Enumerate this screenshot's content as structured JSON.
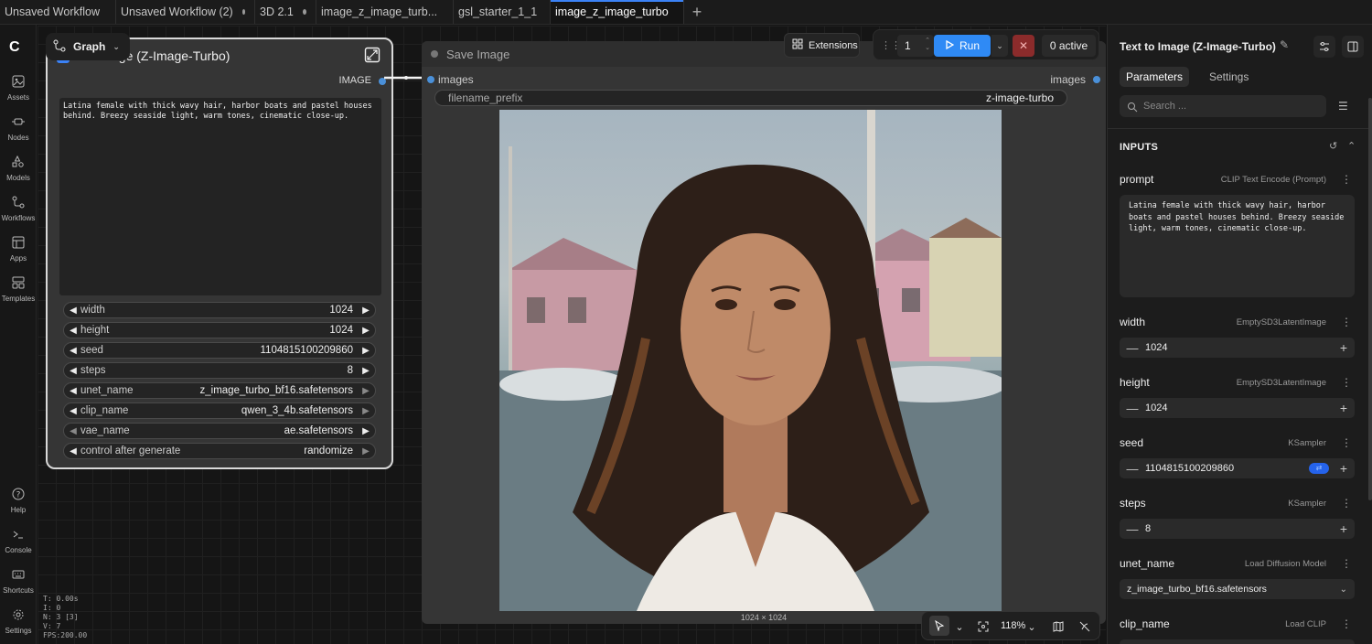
{
  "tabs": [
    {
      "label": "Unsaved Workflow",
      "active": false
    },
    {
      "label": "Unsaved Workflow (2)",
      "active": false
    },
    {
      "label": "3D 2.1",
      "active": false
    },
    {
      "label": "image_z_image_turb...",
      "active": false
    },
    {
      "label": "gsl_starter_1_1",
      "active": false
    },
    {
      "label": "image_z_image_turbo",
      "active": true
    }
  ],
  "nav": {
    "logo": "C",
    "items": [
      {
        "label": "Assets",
        "icon": "image-icon"
      },
      {
        "label": "Nodes",
        "icon": "nodes-icon"
      },
      {
        "label": "Models",
        "icon": "models-icon"
      },
      {
        "label": "Workflows",
        "icon": "workflows-icon"
      },
      {
        "label": "Apps",
        "icon": "apps-icon"
      },
      {
        "label": "Templates",
        "icon": "templates-icon"
      },
      {
        "label": "Help",
        "icon": "help-icon"
      },
      {
        "label": "Console",
        "icon": "console-icon"
      },
      {
        "label": "Shortcuts",
        "icon": "keyboard-icon"
      },
      {
        "label": "Settings",
        "icon": "gear-icon"
      }
    ]
  },
  "graph_pill": {
    "label": "Graph"
  },
  "node1": {
    "title": "age (Z-Image-Turbo)",
    "output_label": "IMAGE",
    "prompt": "Latina female with thick wavy hair, harbor boats and pastel houses behind. Breezy seaside light, warm tones, cinematic close-up.",
    "widgets": [
      {
        "name": "width",
        "value": "1024"
      },
      {
        "name": "height",
        "value": "1024"
      },
      {
        "name": "seed",
        "value": "1104815100209860"
      },
      {
        "name": "steps",
        "value": "8"
      },
      {
        "name": "unet_name",
        "value": "z_image_turbo_bf16.safetensors"
      },
      {
        "name": "clip_name",
        "value": "qwen_3_4b.safetensors"
      },
      {
        "name": "vae_name",
        "value": "ae.safetensors"
      },
      {
        "name": "control after generate",
        "value": "randomize"
      }
    ]
  },
  "node2": {
    "title": "Save Image",
    "input_label": "images",
    "output_label": "images",
    "filename_prefix": {
      "name": "filename_prefix",
      "value": "z-image-turbo"
    },
    "image_caption": "1024 × 1024"
  },
  "stats": {
    "t": "T: 0.00s",
    "i": "I: 0",
    "n": "N: 3 [3]",
    "v": "V: 7",
    "fps": "FPS:200.00"
  },
  "toolbar": {
    "extensions": "Extensions",
    "queue_count": "1",
    "run": "Run",
    "active": "0 active"
  },
  "bottom": {
    "zoom": "118%"
  },
  "panel": {
    "title": "Text to Image (Z-Image-Turbo)",
    "tabs": [
      "Parameters",
      "Settings"
    ],
    "search_placeholder": "Search ...",
    "section": "INPUTS",
    "prompt": {
      "name": "prompt",
      "source": "CLIP Text Encode (Prompt)",
      "value": "Latina female with thick wavy hair, harbor boats and pastel houses behind. Breezy seaside light, warm tones, cinematic close-up."
    },
    "width": {
      "name": "width",
      "source": "EmptySD3LatentImage",
      "value": "1024"
    },
    "height": {
      "name": "height",
      "source": "EmptySD3LatentImage",
      "value": "1024"
    },
    "seed": {
      "name": "seed",
      "source": "KSampler",
      "value": "1104815100209860"
    },
    "steps": {
      "name": "steps",
      "source": "KSampler",
      "value": "8"
    },
    "unet_name": {
      "name": "unet_name",
      "source": "Load Diffusion Model",
      "value": "z_image_turbo_bf16.safetensors"
    },
    "clip_name": {
      "name": "clip_name",
      "source": "Load CLIP"
    }
  },
  "colors": {
    "accent": "#2f8af5",
    "cancel": "#8b2b2b",
    "slot": "#4a90d9"
  }
}
